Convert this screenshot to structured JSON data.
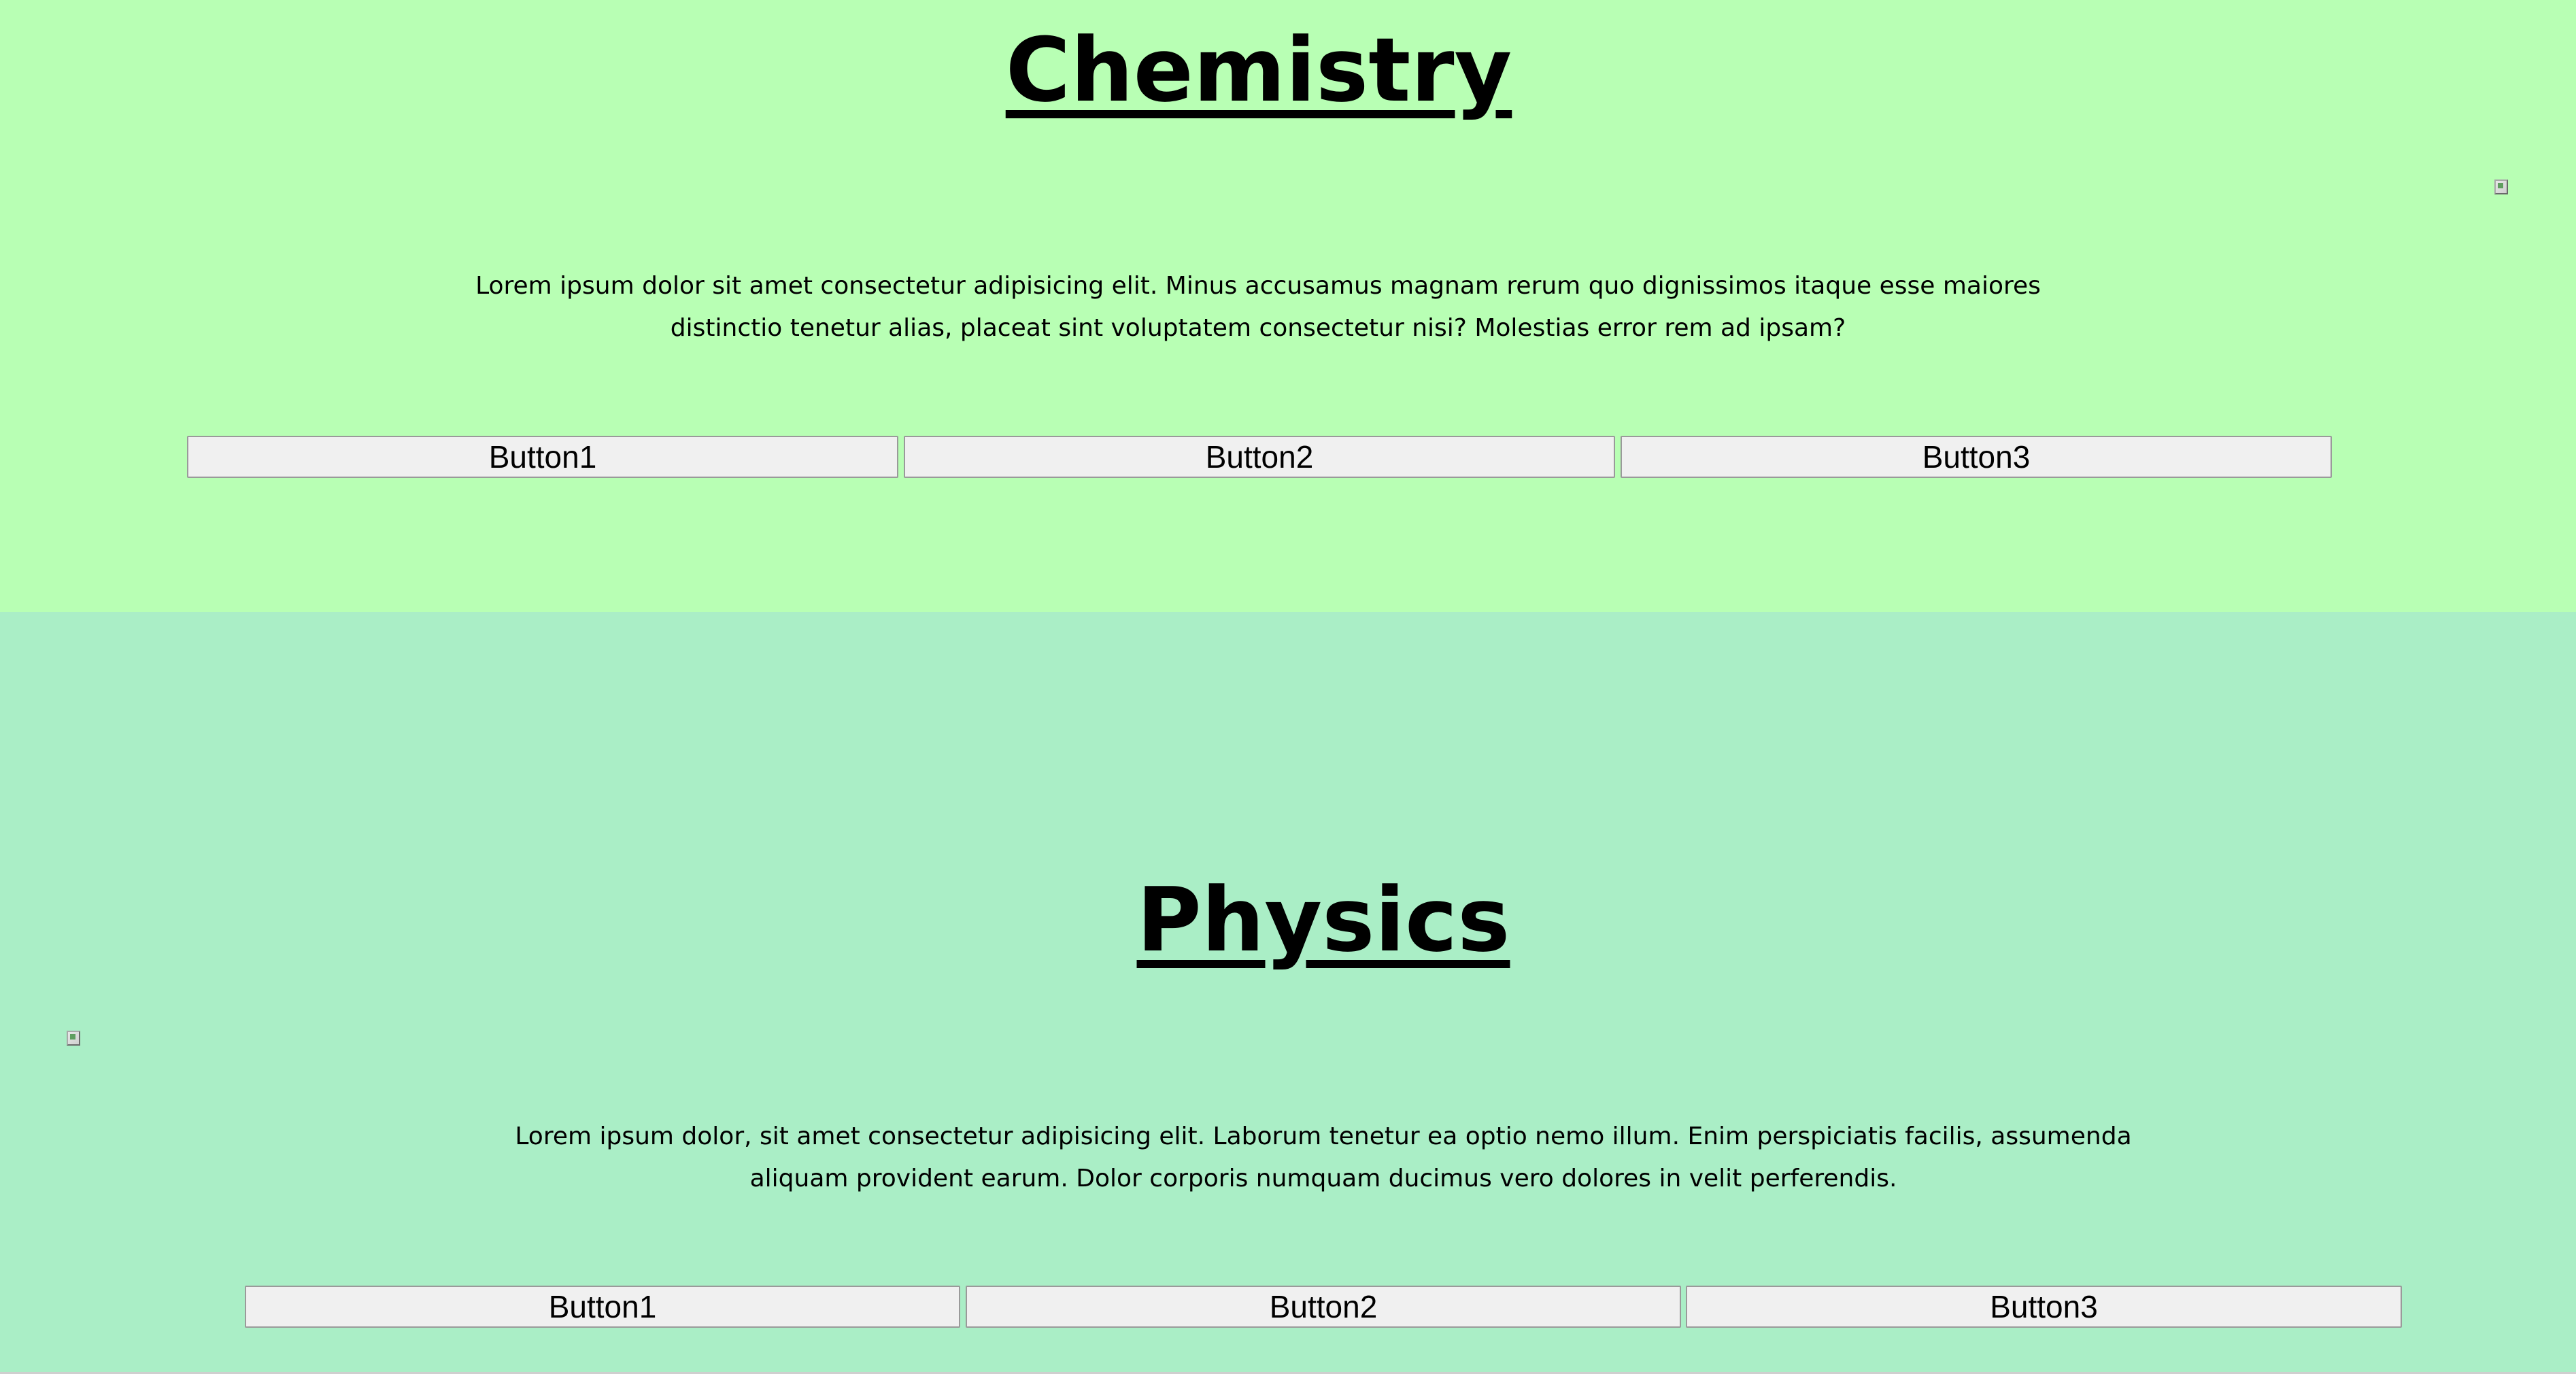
{
  "sections": [
    {
      "title": "Chemistry",
      "paragraph_line1": "Lorem ipsum dolor sit amet consectetur adipisicing elit. Minus accusamus magnam rerum quo dignissimos itaque esse maiores",
      "paragraph_line2": "distinctio tenetur alias, placeat sint voluptatem consectetur nisi? Molestias error rem ad ipsam?",
      "buttons": [
        "Button1",
        "Button2",
        "Button3"
      ],
      "background": "#b8ffb4"
    },
    {
      "title": "Physics",
      "paragraph_line1": "Lorem ipsum dolor, sit amet consectetur adipisicing elit. Laborum tenetur ea optio nemo illum. Enim perspiciatis facilis, assumenda",
      "paragraph_line2": "aliquam provident earum. Dolor corporis numquam ducimus vero dolores in velit perferendis.",
      "buttons": [
        "Button1",
        "Button2",
        "Button3"
      ],
      "background": "#aaeec6"
    }
  ],
  "icons": {
    "image_placeholder": "broken-image-icon"
  }
}
